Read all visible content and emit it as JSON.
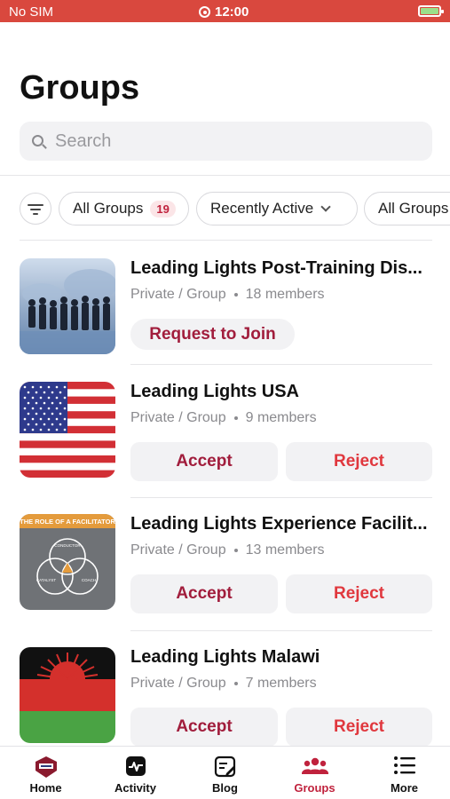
{
  "status_bar": {
    "carrier": "No SIM",
    "time": "12:00"
  },
  "page_title": "Groups",
  "search": {
    "placeholder": "Search"
  },
  "filters": {
    "all_groups_label": "All Groups",
    "all_groups_count": "19",
    "sort_label": "Recently Active",
    "type_label": "All Groups"
  },
  "groups": [
    {
      "name": "Leading Lights Post-Training Dis...",
      "privacy": "Private / Group",
      "members": "18 members",
      "action": "Request to Join",
      "thumb_icon": "business-people-icon"
    },
    {
      "name": "Leading Lights USA",
      "privacy": "Private / Group",
      "members": "9 members",
      "accept_label": "Accept",
      "reject_label": "Reject",
      "thumb_icon": "usa-flag-icon"
    },
    {
      "name": "Leading Lights Experience Facilit...",
      "privacy": "Private / Group",
      "members": "13 members",
      "accept_label": "Accept",
      "reject_label": "Reject",
      "thumb_icon": "facilitator-venn-diagram-icon",
      "thumb_texts": {
        "banner": "THE ROLE OF A FACILITATOR",
        "top": "CONDUCTOR",
        "left": "CATALYST",
        "right": "COACH"
      }
    },
    {
      "name": "Leading Lights Malawi",
      "privacy": "Private / Group",
      "members": "7 members",
      "accept_label": "Accept",
      "reject_label": "Reject",
      "thumb_icon": "malawi-flag-icon"
    }
  ],
  "tabs": [
    {
      "label": "Home",
      "icon": "home-logo-icon"
    },
    {
      "label": "Activity",
      "icon": "activity-icon"
    },
    {
      "label": "Blog",
      "icon": "blog-icon"
    },
    {
      "label": "Groups",
      "icon": "groups-icon",
      "active": true
    },
    {
      "label": "More",
      "icon": "menu-icon"
    }
  ],
  "colors": {
    "status_bar": "#d9483e",
    "accent": "#c0223d",
    "reject": "#e0383e"
  }
}
